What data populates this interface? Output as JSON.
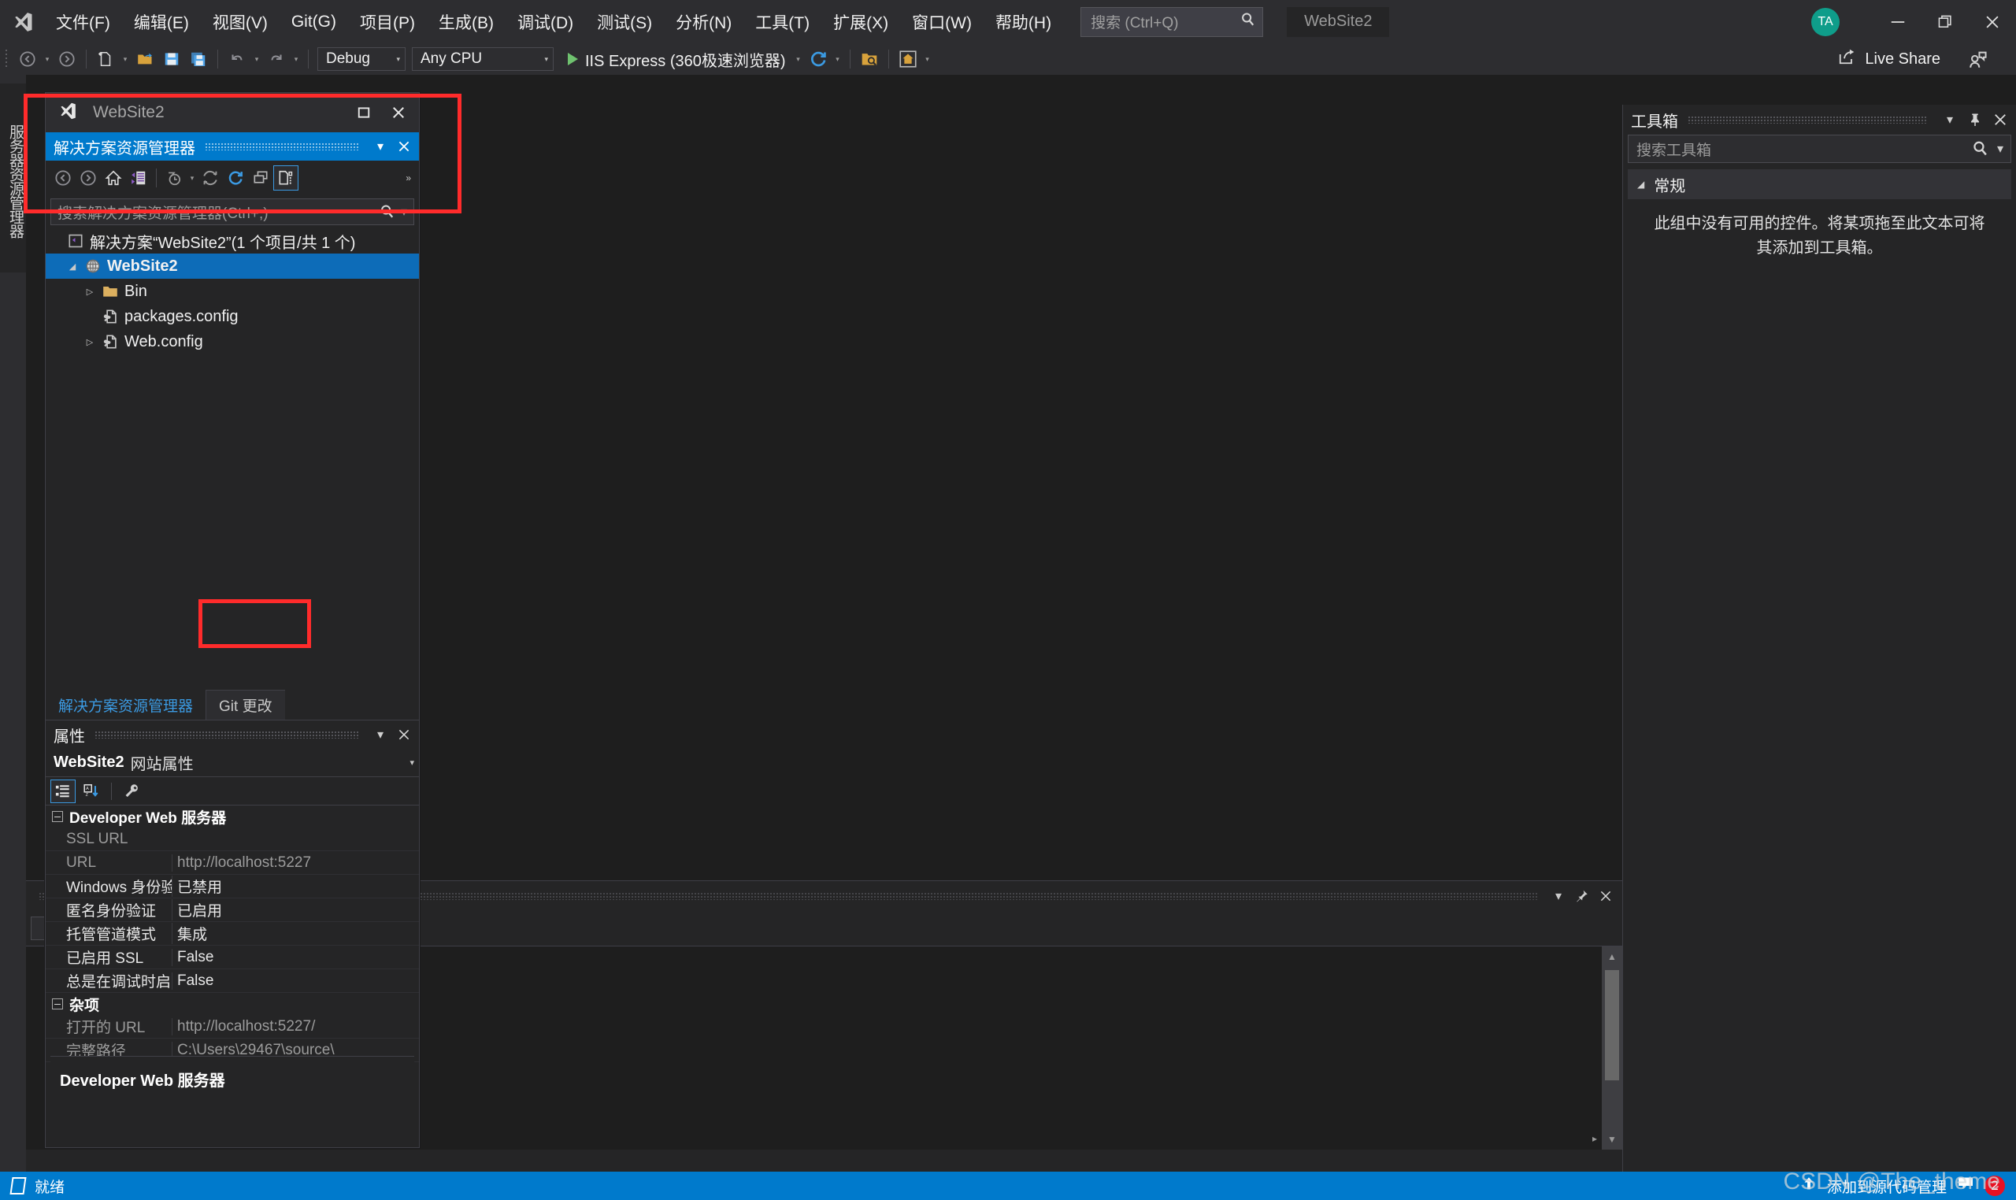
{
  "app": {
    "title": "WebSite2",
    "avatar_initials": "TA",
    "live_share_label": "Live Share"
  },
  "menu": {
    "items": [
      {
        "label": "文件(F)"
      },
      {
        "label": "编辑(E)"
      },
      {
        "label": "视图(V)"
      },
      {
        "label": "Git(G)"
      },
      {
        "label": "项目(P)"
      },
      {
        "label": "生成(B)"
      },
      {
        "label": "调试(D)"
      },
      {
        "label": "测试(S)"
      },
      {
        "label": "分析(N)"
      },
      {
        "label": "工具(T)"
      },
      {
        "label": "扩展(X)"
      },
      {
        "label": "窗口(W)"
      },
      {
        "label": "帮助(H)"
      }
    ],
    "search_placeholder": "搜索 (Ctrl+Q)"
  },
  "toolbar": {
    "config": "Debug",
    "platform": "Any CPU",
    "run_target": "IIS Express (360极速浏览器)"
  },
  "left_vertical_tab": {
    "label": "服务器资源管理器"
  },
  "float_window": {
    "title": "WebSite2",
    "solution_explorer": {
      "header": "解决方案资源管理器",
      "search_placeholder": "搜索解决方案资源管理器(Ctrl+;)",
      "tree": [
        {
          "label": "解决方案“WebSite2”(1 个项目/共 1 个)",
          "icon": "solution-icon",
          "indent": 0,
          "expander": "none",
          "selected": false,
          "bold": false
        },
        {
          "label": "WebSite2",
          "icon": "website-icon",
          "indent": 1,
          "expander": "expanded",
          "selected": true,
          "bold": true
        },
        {
          "label": "Bin",
          "icon": "folder-icon",
          "indent": 2,
          "expander": "collapsed",
          "selected": false,
          "bold": false
        },
        {
          "label": "packages.config",
          "icon": "config-icon",
          "indent": 2,
          "expander": "none",
          "selected": false,
          "bold": false
        },
        {
          "label": "Web.config",
          "icon": "config-icon",
          "indent": 2,
          "expander": "collapsed",
          "selected": false,
          "bold": false
        }
      ]
    },
    "tabs": [
      {
        "label": "解决方案资源管理器",
        "active": true
      },
      {
        "label": "Git 更改",
        "active": false
      }
    ],
    "properties": {
      "panel_title": "属性",
      "object_name": "WebSite2",
      "object_kind": "网站属性",
      "groups": [
        {
          "name": "Developer Web 服务器",
          "rows": [
            {
              "key": "SSL URL",
              "value": "",
              "dim": true
            },
            {
              "key": "URL",
              "value": "http://localhost:5227",
              "dim": true
            },
            {
              "key": "Windows 身份验证",
              "value": "已禁用",
              "dim": false
            },
            {
              "key": "匿名身份验证",
              "value": "已启用",
              "dim": false
            },
            {
              "key": "托管管道模式",
              "value": "集成",
              "dim": false
            },
            {
              "key": "已启用 SSL",
              "value": "False",
              "dim": false
            },
            {
              "key": "总是在调试时启动",
              "value": "False",
              "dim": false
            }
          ]
        },
        {
          "name": "杂项",
          "rows": [
            {
              "key": "打开的 URL",
              "value": "http://localhost:5227/",
              "dim": true
            },
            {
              "key": "完整路径",
              "value": "C:\\Users\\29467\\source\\",
              "dim": true
            }
          ]
        }
      ],
      "description_title": "Developer Web 服务器"
    }
  },
  "toolbox": {
    "title": "工具箱",
    "search_placeholder": "搜索工具箱",
    "group_label": "常规",
    "empty_message": "此组中没有可用的控件。将某项拖至此文本可将其添加到工具箱。"
  },
  "statusbar": {
    "left_text": "就绪",
    "right_text": "添加到源代码管理",
    "notification_count": "2"
  },
  "watermark": {
    "text": "CSDN @The_theme"
  },
  "colors": {
    "accent": "#007acc",
    "annotation": "#ff2b2b",
    "selection": "#0d6cb8",
    "avatar": "#0f9d8a",
    "run_green": "#6fc26f"
  }
}
